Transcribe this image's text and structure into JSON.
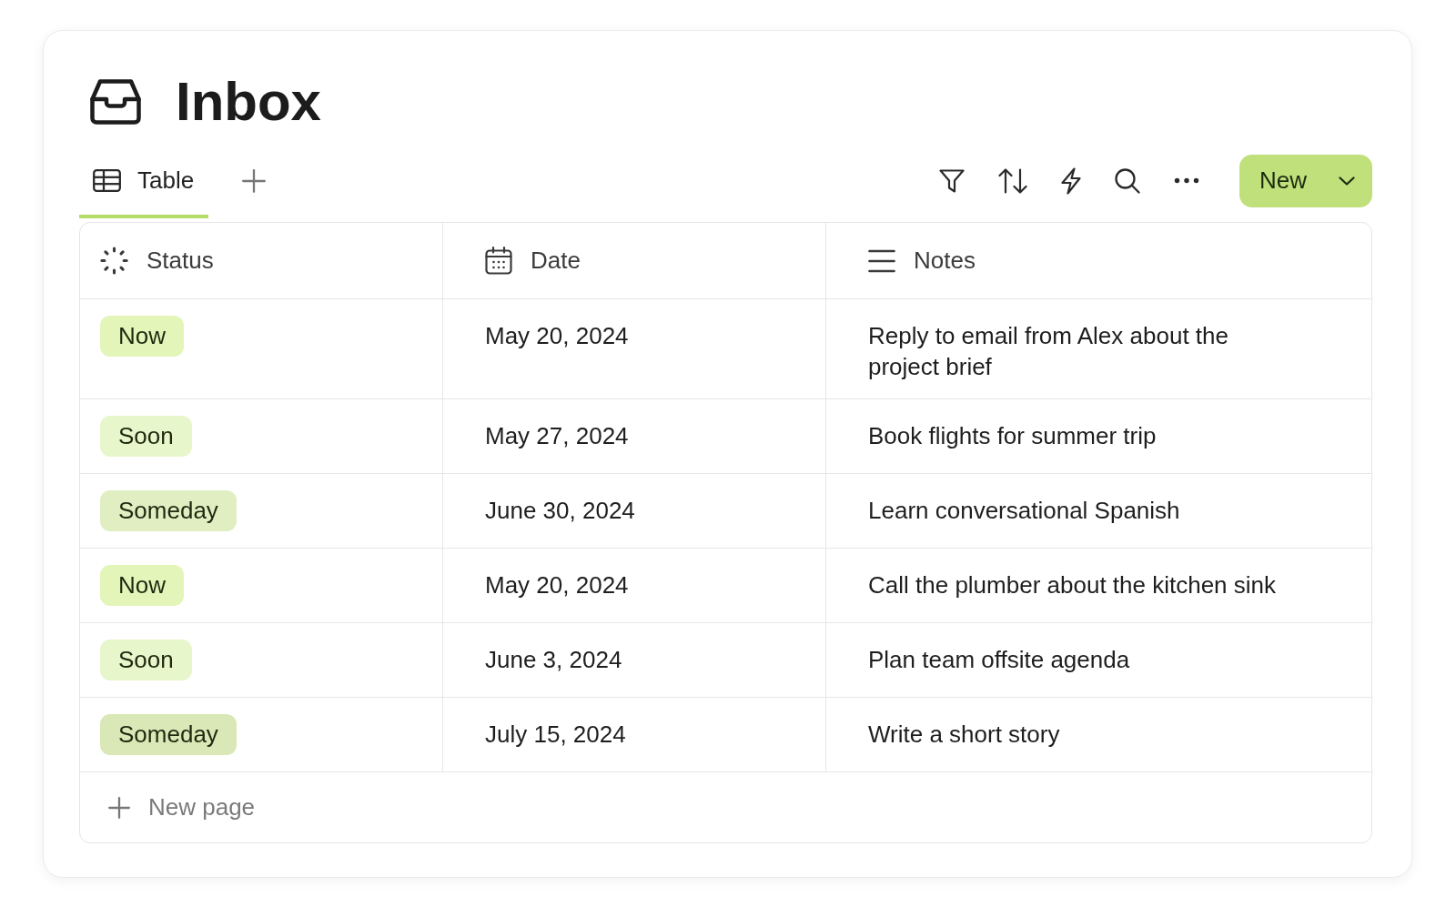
{
  "page": {
    "title": "Inbox"
  },
  "views": {
    "tabs": [
      {
        "label": "Table",
        "selected": true
      }
    ]
  },
  "toolbar": {
    "new_button": "New"
  },
  "table": {
    "columns": [
      {
        "label": "Status",
        "kind": "status"
      },
      {
        "label": "Date",
        "kind": "date"
      },
      {
        "label": "Notes",
        "kind": "text"
      }
    ],
    "rows": [
      {
        "status": {
          "label": "Now",
          "color": "#e3f5b9"
        },
        "date": "May 20, 2024",
        "notes": "Reply to email from Alex about the project brief"
      },
      {
        "status": {
          "label": "Soon",
          "color": "#e8f6cb"
        },
        "date": "May 27, 2024",
        "notes": "Book flights for summer trip"
      },
      {
        "status": {
          "label": "Someday",
          "color": "#e0eec2"
        },
        "date": "June 30, 2024",
        "notes": "Learn conversational Spanish"
      },
      {
        "status": {
          "label": "Now",
          "color": "#e3f5b9"
        },
        "date": "May 20, 2024",
        "notes": "Call the plumber about the kitchen sink"
      },
      {
        "status": {
          "label": "Soon",
          "color": "#e8f6cb"
        },
        "date": "June 3, 2024",
        "notes": "Plan team offsite agenda"
      },
      {
        "status": {
          "label": "Someday",
          "color": "#d9e8b6"
        },
        "date": "July 15, 2024",
        "notes": "Write a short story"
      }
    ],
    "new_row": "New page"
  }
}
